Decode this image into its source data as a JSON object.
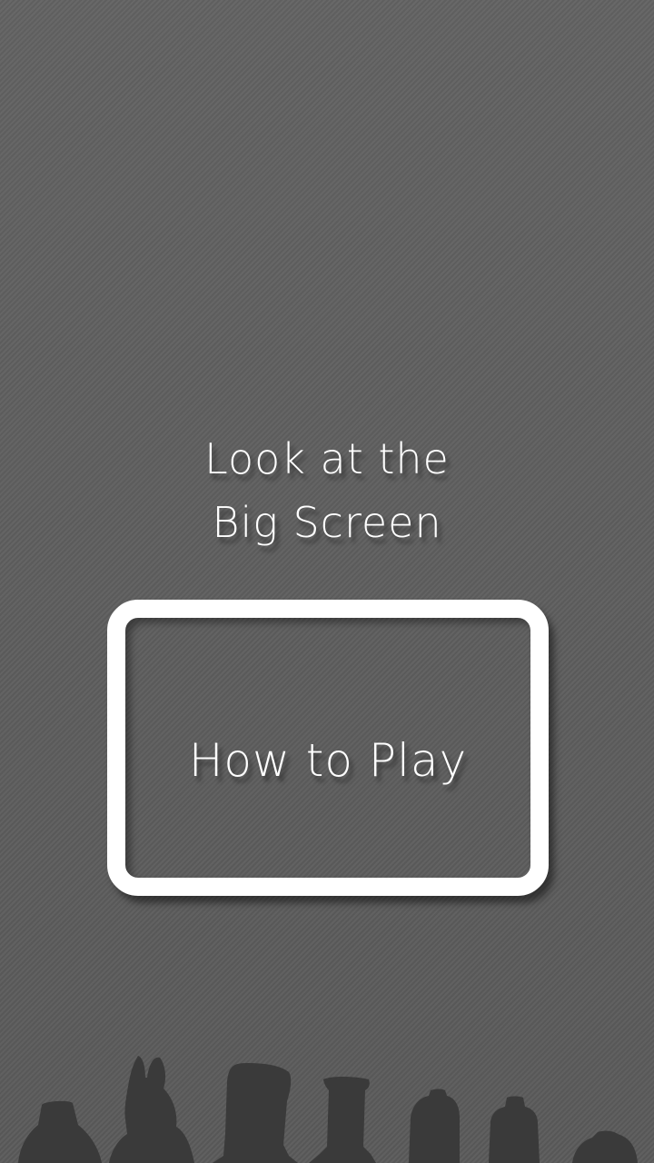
{
  "instruction": {
    "line1": "Look at the",
    "line2": "Big Screen"
  },
  "how_to_play": {
    "label": "How to Play"
  },
  "decor": {
    "silhouettes": "character-silhouettes"
  },
  "colors": {
    "background": "#5f5f5f",
    "text": "#ffffff",
    "silhouette": "#3a3a3a"
  }
}
